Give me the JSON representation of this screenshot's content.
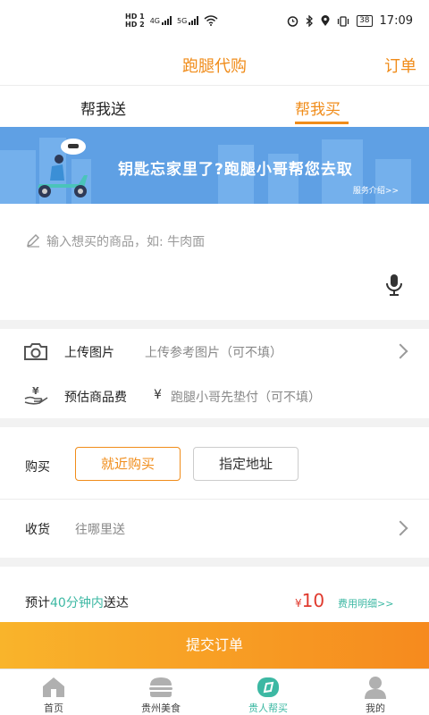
{
  "status_bar": {
    "hd1": "HD 1",
    "hd2": "HD 2",
    "sig1": "4G",
    "sig2": "5G",
    "battery": "38",
    "time": "17:09"
  },
  "header": {
    "title": "跑腿代购",
    "orders": "订单"
  },
  "tabs": [
    {
      "label": "帮我送",
      "active": false
    },
    {
      "label": "帮我买",
      "active": true
    }
  ],
  "banner": {
    "text": "钥匙忘家里了?跑腿小哥帮您去取",
    "link": "服务介绍>>"
  },
  "input": {
    "placeholder": "输入想买的商品，如: 牛肉面"
  },
  "upload": {
    "label": "上传图片",
    "hint": "上传参考图片（可不填）"
  },
  "estimate": {
    "label": "预估商品费",
    "currency": "¥",
    "hint": "跑腿小哥先垫付（可不填）"
  },
  "buy": {
    "label": "购买",
    "nearby": "就近购买",
    "specify": "指定地址"
  },
  "receive": {
    "label": "收货",
    "hint": "往哪里送"
  },
  "eta": {
    "prefix": "预计",
    "time": "40分钟内",
    "suffix": "送达"
  },
  "price": {
    "currency": "¥",
    "amount": "10",
    "detail": "费用明细>>"
  },
  "submit": {
    "label": "提交订单"
  },
  "nav": [
    {
      "label": "首页",
      "icon": "home-icon",
      "active": false
    },
    {
      "label": "贵州美食",
      "icon": "burger-icon",
      "active": false
    },
    {
      "label": "贵人帮买",
      "icon": "help-buy-icon",
      "active": true
    },
    {
      "label": "我的",
      "icon": "profile-icon",
      "active": false
    }
  ],
  "colors": {
    "accent": "#f08c1a",
    "teal": "#3cb8a3",
    "price": "#e03a2e",
    "banner": "#5fa0e4"
  }
}
